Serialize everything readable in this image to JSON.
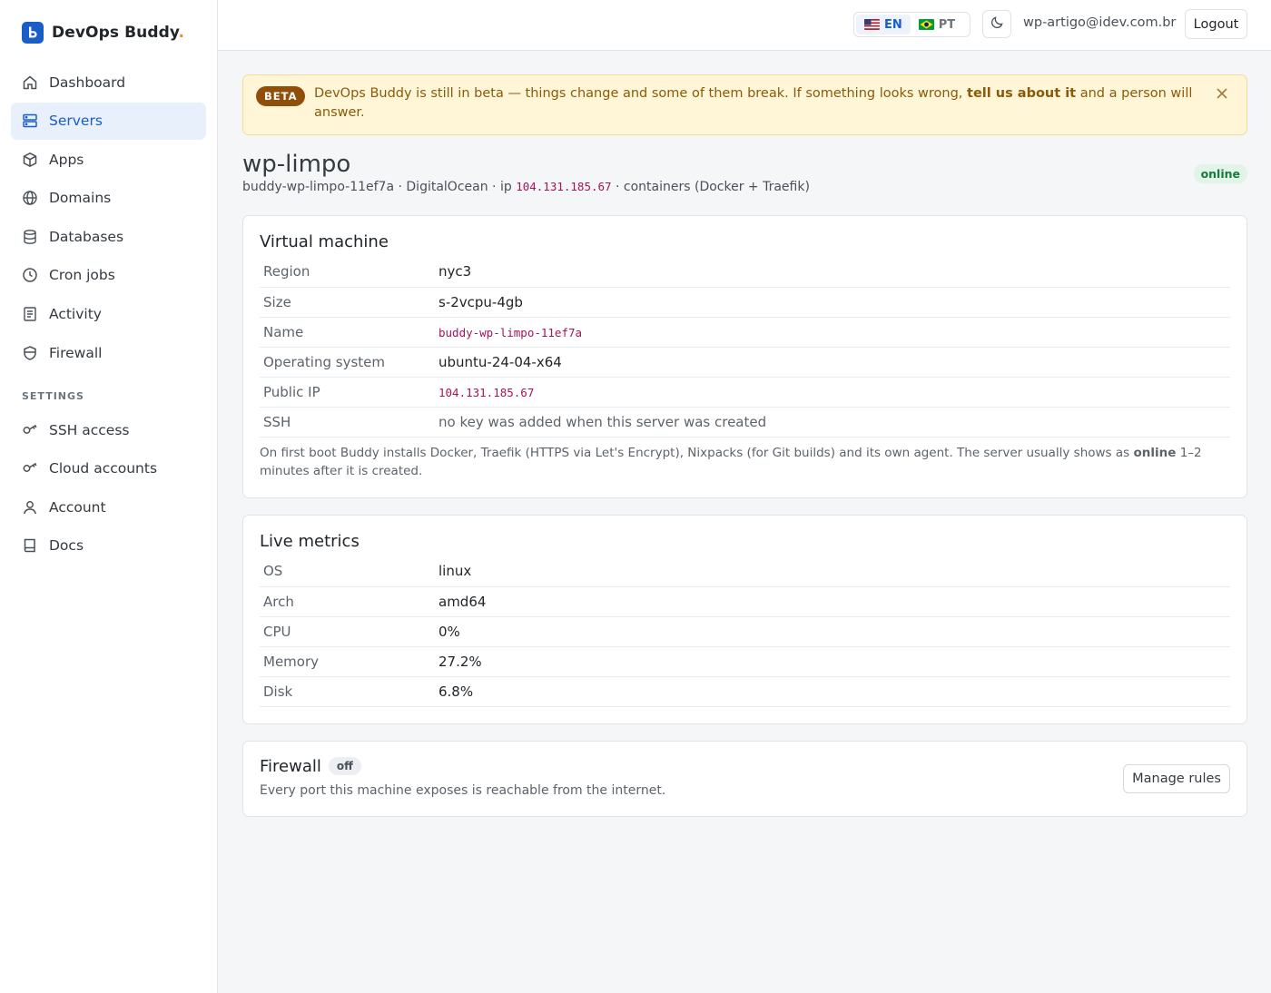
{
  "brand": {
    "name": "DevOps Buddy",
    "dot": ".",
    "logo_letter": "b"
  },
  "sidebar": {
    "items": [
      {
        "label": "Dashboard",
        "icon": "home-icon"
      },
      {
        "label": "Servers",
        "icon": "server-icon",
        "active": true
      },
      {
        "label": "Apps",
        "icon": "box-icon"
      },
      {
        "label": "Domains",
        "icon": "globe-icon"
      },
      {
        "label": "Databases",
        "icon": "database-icon"
      },
      {
        "label": "Cron jobs",
        "icon": "clock-icon"
      },
      {
        "label": "Activity",
        "icon": "list-icon"
      },
      {
        "label": "Firewall",
        "icon": "shield-icon"
      }
    ],
    "settings_heading": "SETTINGS",
    "settings_items": [
      {
        "label": "SSH access",
        "icon": "key-icon"
      },
      {
        "label": "Cloud accounts",
        "icon": "key-icon"
      },
      {
        "label": "Account",
        "icon": "user-icon"
      },
      {
        "label": "Docs",
        "icon": "book-icon"
      }
    ]
  },
  "topbar": {
    "lang_en": "EN",
    "lang_pt": "PT",
    "user_email": "wp-artigo@idev.com.br",
    "logout_label": "Logout"
  },
  "beta": {
    "badge": "BETA",
    "text_before": "DevOps Buddy is still in beta — things change and some of them break. If something looks wrong, ",
    "link": "tell us about it",
    "text_after": " and a person will answer."
  },
  "server": {
    "name": "wp-limpo",
    "hostname": "buddy-wp-limpo-11ef7a",
    "provider": "DigitalOcean",
    "ip_label": "ip",
    "ip": "104.131.185.67",
    "runtime": "containers (Docker + Traefik)",
    "status": "online"
  },
  "vm_card": {
    "title": "Virtual machine",
    "rows": [
      {
        "key": "Region",
        "value": "nyc3"
      },
      {
        "key": "Size",
        "value": "s-2vcpu-4gb"
      },
      {
        "key": "Name",
        "value": "buddy-wp-limpo-11ef7a"
      },
      {
        "key": "Operating system",
        "value": "ubuntu-24-04-x64"
      },
      {
        "key": "Public IP",
        "value": "104.131.185.67"
      },
      {
        "key": "SSH",
        "value": "no key was added when this server was created"
      }
    ],
    "note_before": "On first boot Buddy installs Docker, Traefik (HTTPS via Let's Encrypt), Nixpacks (for Git builds) and its own agent. The server usually shows as ",
    "note_bold": "online",
    "note_after": " 1–2 minutes after it is created."
  },
  "metrics_card": {
    "title": "Live metrics",
    "rows": [
      {
        "key": "OS",
        "value": "linux"
      },
      {
        "key": "Arch",
        "value": "amd64"
      },
      {
        "key": "CPU",
        "value": "0%"
      },
      {
        "key": "Memory",
        "value": "27.2%"
      },
      {
        "key": "Disk",
        "value": "6.8%"
      }
    ]
  },
  "firewall_card": {
    "title": "Firewall",
    "status": "off",
    "description": "Every port this machine exposes is reachable from the internet.",
    "button_label": "Manage rules"
  }
}
